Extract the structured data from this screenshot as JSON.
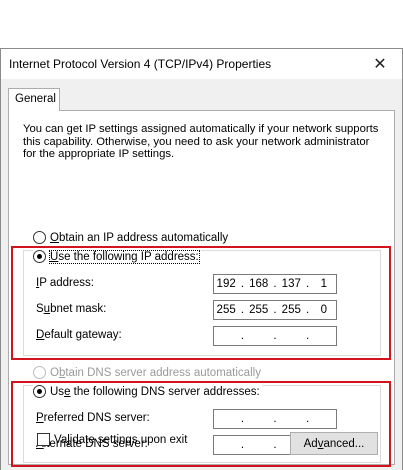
{
  "window": {
    "title": "Internet Protocol Version 4 (TCP/IPv4) Properties",
    "close_glyph": "✕"
  },
  "tabs": [
    {
      "label": "General"
    }
  ],
  "intro_text": "You can get IP settings assigned automatically if your network supports this capability. Otherwise, you need to ask your network administrator for the appropriate IP settings.",
  "ip_mode": {
    "auto": {
      "prefix": "",
      "accel": "O",
      "rest": "btain an IP address automatically",
      "checked": false
    },
    "manual": {
      "prefix": "",
      "accel": "U",
      "rest": "se the following IP address:",
      "checked": true
    }
  },
  "ip_fields": [
    {
      "accel": "I",
      "rest": "P address:",
      "prefix": "",
      "value": [
        "192",
        "168",
        "137",
        "1"
      ]
    },
    {
      "prefix": "S",
      "accel": "u",
      "rest": "bnet mask:",
      "value": [
        "255",
        "255",
        "255",
        "0"
      ]
    },
    {
      "prefix": "",
      "accel": "D",
      "rest": "efault gateway:",
      "value": [
        "",
        "",
        "",
        ""
      ]
    }
  ],
  "dns_mode": {
    "auto": {
      "prefix": "O",
      "accel": "b",
      "rest": "tain DNS server address automatically",
      "checked": false,
      "disabled": true
    },
    "manual": {
      "prefix": "Us",
      "accel": "e",
      "rest": " the following DNS server addresses:",
      "checked": true
    }
  },
  "dns_fields": [
    {
      "prefix": "",
      "accel": "P",
      "rest": "referred DNS server:",
      "value": [
        "",
        "",
        "",
        ""
      ]
    },
    {
      "prefix": "",
      "accel": "A",
      "rest": "lternate DNS server:",
      "value": [
        "",
        "",
        "",
        ""
      ]
    }
  ],
  "validate": {
    "prefix": "Va",
    "accel": "l",
    "rest": "idate settings upon exit",
    "checked": false
  },
  "advanced_button": {
    "prefix": "Ad",
    "accel": "v",
    "rest": "anced..."
  },
  "highlight_color": "#d4141c"
}
